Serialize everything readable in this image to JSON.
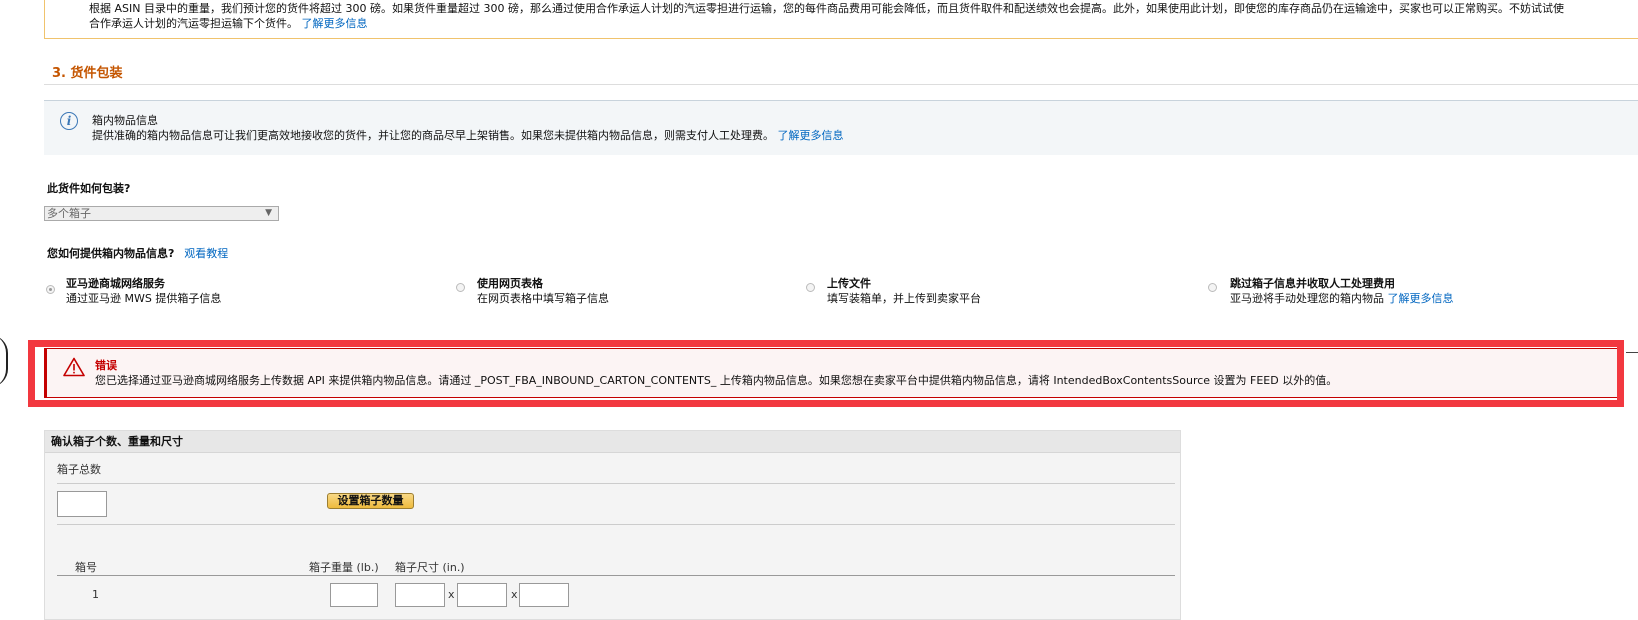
{
  "top_note": {
    "line1": "根据 ASIN 目录中的重量，我们预计您的货件将超过 300 磅。如果货件重量超过 300 磅，那么通过使用合作承运人计划的汽运零担进行运输，您的每件商品费用可能会降低，而且货件取件和配送绩效也会提高。此外，如果使用此计划，即使您的库存商品仍在运输途中，买家也可以正常购买。不妨试试使",
    "line2": "合作承运人计划的汽运零担运输下个货件。",
    "link": "了解更多信息"
  },
  "section": {
    "title": "3. 货件包装"
  },
  "info": {
    "icon": "info-icon",
    "title": "箱内物品信息",
    "text": "提供准确的箱内物品信息可让我们更高效地接收您的货件，并让您的商品尽早上架销售。如果您未提供箱内物品信息，则需支付人工处理费。",
    "link": "了解更多信息"
  },
  "packing": {
    "question": "此货件如何包装?",
    "selected": "多个箱子",
    "arrow": "▼"
  },
  "contents": {
    "question": "您如何提供箱内物品信息?",
    "tutorial_link": "观看教程",
    "options": [
      {
        "title": "亚马逊商城网络服务",
        "desc": "通过亚马逊 MWS 提供箱子信息",
        "checked": true
      },
      {
        "title": "使用网页表格",
        "desc": "在网页表格中填写箱子信息",
        "checked": false
      },
      {
        "title": "上传文件",
        "desc": "填写装箱单，并上传到卖家平台",
        "checked": false
      },
      {
        "title": "跳过箱子信息并收取人工处理费用",
        "desc": "亚马逊将手动处理您的箱内物品",
        "link": "了解更多信息",
        "checked": false
      }
    ]
  },
  "error": {
    "icon": "warning-icon",
    "title": "错误",
    "text": "您已选择通过亚马逊商城网络服务上传数据 API 来提供箱内物品信息。请通过 _POST_FBA_INBOUND_CARTON_CONTENTS_ 上传箱内物品信息。如果您想在卖家平台中提供箱内物品信息，请将 IntendedBoxContentsSource 设置为 FEED 以外的值。",
    "highlight_color": "#f2383f"
  },
  "boxes": {
    "header": "确认箱子个数、重量和尺寸",
    "total_label": "箱子总数",
    "set_button": "设置箱子数量",
    "col_box": "箱号",
    "col_weight": "箱子重量 (lb.)",
    "col_dims": "箱子尺寸 (in.)",
    "row_number": "1",
    "times": "x"
  }
}
